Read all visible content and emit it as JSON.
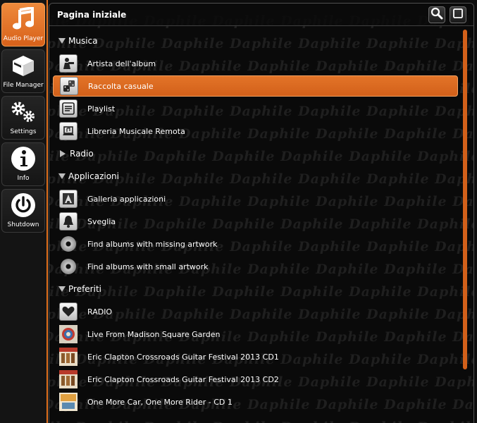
{
  "sidebar": {
    "items": [
      {
        "label": "Audio Player",
        "icon": "music-note-icon",
        "active": true
      },
      {
        "label": "File Manager",
        "icon": "file-manager-icon",
        "active": false
      },
      {
        "label": "Settings",
        "icon": "gears-icon",
        "active": false
      },
      {
        "label": "Info",
        "icon": "info-icon",
        "active": false
      },
      {
        "label": "Shutdown",
        "icon": "power-icon",
        "active": false
      }
    ]
  },
  "header": {
    "title": "Pagina iniziale",
    "search_icon": "search-icon",
    "window_icon": "window-icon"
  },
  "watermark_text": "Daphile",
  "sections": {
    "musica": {
      "label": "Musica",
      "expanded": true,
      "items": [
        {
          "label": "Artista dell'album",
          "icon": "album-artist-icon"
        },
        {
          "label": "Raccolta casuale",
          "icon": "dice-icon",
          "selected": true
        },
        {
          "label": "Playlist",
          "icon": "playlist-icon"
        },
        {
          "label": "Libreria Musicale Remota",
          "icon": "remote-library-icon"
        }
      ]
    },
    "radio": {
      "label": "Radio",
      "expanded": false
    },
    "applicazioni": {
      "label": "Applicazioni",
      "expanded": true,
      "items": [
        {
          "label": "Galleria applicazioni",
          "icon": "app-gallery-icon"
        },
        {
          "label": "Sveglia",
          "icon": "bell-icon"
        },
        {
          "label": "Find albums with missing artwork",
          "icon": "disc-icon"
        },
        {
          "label": "Find albums with small artwork",
          "icon": "disc-icon"
        }
      ]
    },
    "preferiti": {
      "label": "Preferiti",
      "expanded": true,
      "items": [
        {
          "label": "RADIO",
          "icon": "heart-icon"
        },
        {
          "label": "Live From Madison Square Garden",
          "icon": "album-cover-icon"
        },
        {
          "label": "Eric Clapton Crossroads Guitar Festival 2013 CD1",
          "icon": "album-cover-icon"
        },
        {
          "label": "Eric Clapton Crossroads Guitar Festival 2013 CD2",
          "icon": "album-cover-icon"
        },
        {
          "label": "One More Car, One More Rider - CD 1",
          "icon": "album-cover-icon"
        }
      ]
    }
  },
  "colors": {
    "accent": "#d8611a",
    "background": "#0d0d0d"
  }
}
